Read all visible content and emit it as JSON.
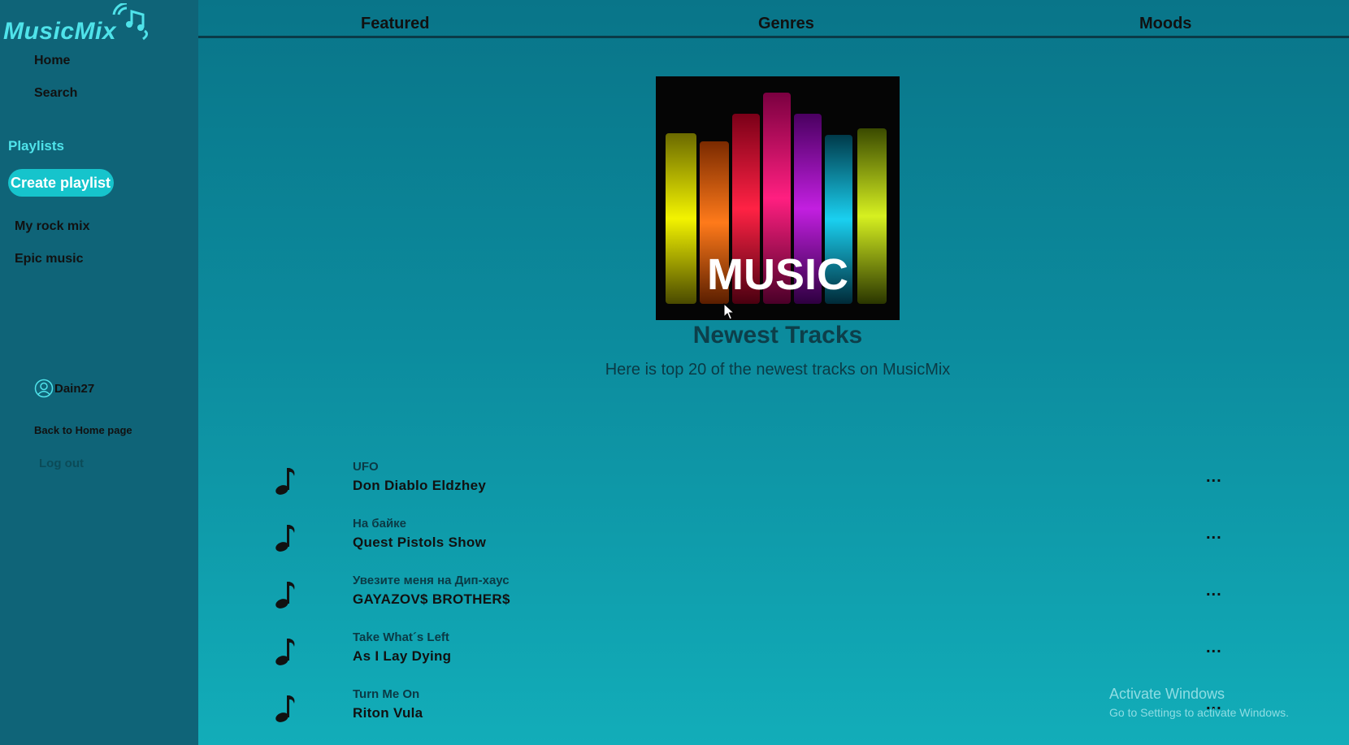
{
  "app": {
    "logo_text": "MusicMix"
  },
  "sidebar": {
    "nav": [
      {
        "label": "Home"
      },
      {
        "label": "Search"
      }
    ],
    "playlists_title": "Playlists",
    "create_button": "Create playlist",
    "playlists": [
      {
        "label": "My rock mix"
      },
      {
        "label": "Epic music"
      }
    ],
    "user": {
      "name": "Dain27"
    },
    "back_home": "Back to Home page",
    "logout": "Log out"
  },
  "tabs": [
    {
      "label": "Featured"
    },
    {
      "label": "Genres"
    },
    {
      "label": "Moods"
    }
  ],
  "hero": {
    "cover_text": "MUSIC",
    "heading": "Newest Tracks",
    "subheading": "Here is top 20 of the newest tracks on MusicMix"
  },
  "tracks": [
    {
      "title": "UFO",
      "artist": "Don Diablo  Eldzhey",
      "more": "..."
    },
    {
      "title": "На байке",
      "artist": "Quest Pistols Show",
      "more": "..."
    },
    {
      "title": "Увезите меня на Дип-хаус",
      "artist": "GAYAZOV$ BROTHER$",
      "more": "..."
    },
    {
      "title": "Take What´s Left",
      "artist": "As I Lay Dying",
      "more": "..."
    },
    {
      "title": "Turn Me On",
      "artist": "Riton  Vula",
      "more": "..."
    }
  ],
  "watermark": {
    "title": "Activate Windows",
    "subtitle": "Go to Settings to activate Windows."
  },
  "colors": {
    "accent": "#4fe3ea",
    "button": "#16c4cc",
    "sidebar": "#0f6478"
  }
}
